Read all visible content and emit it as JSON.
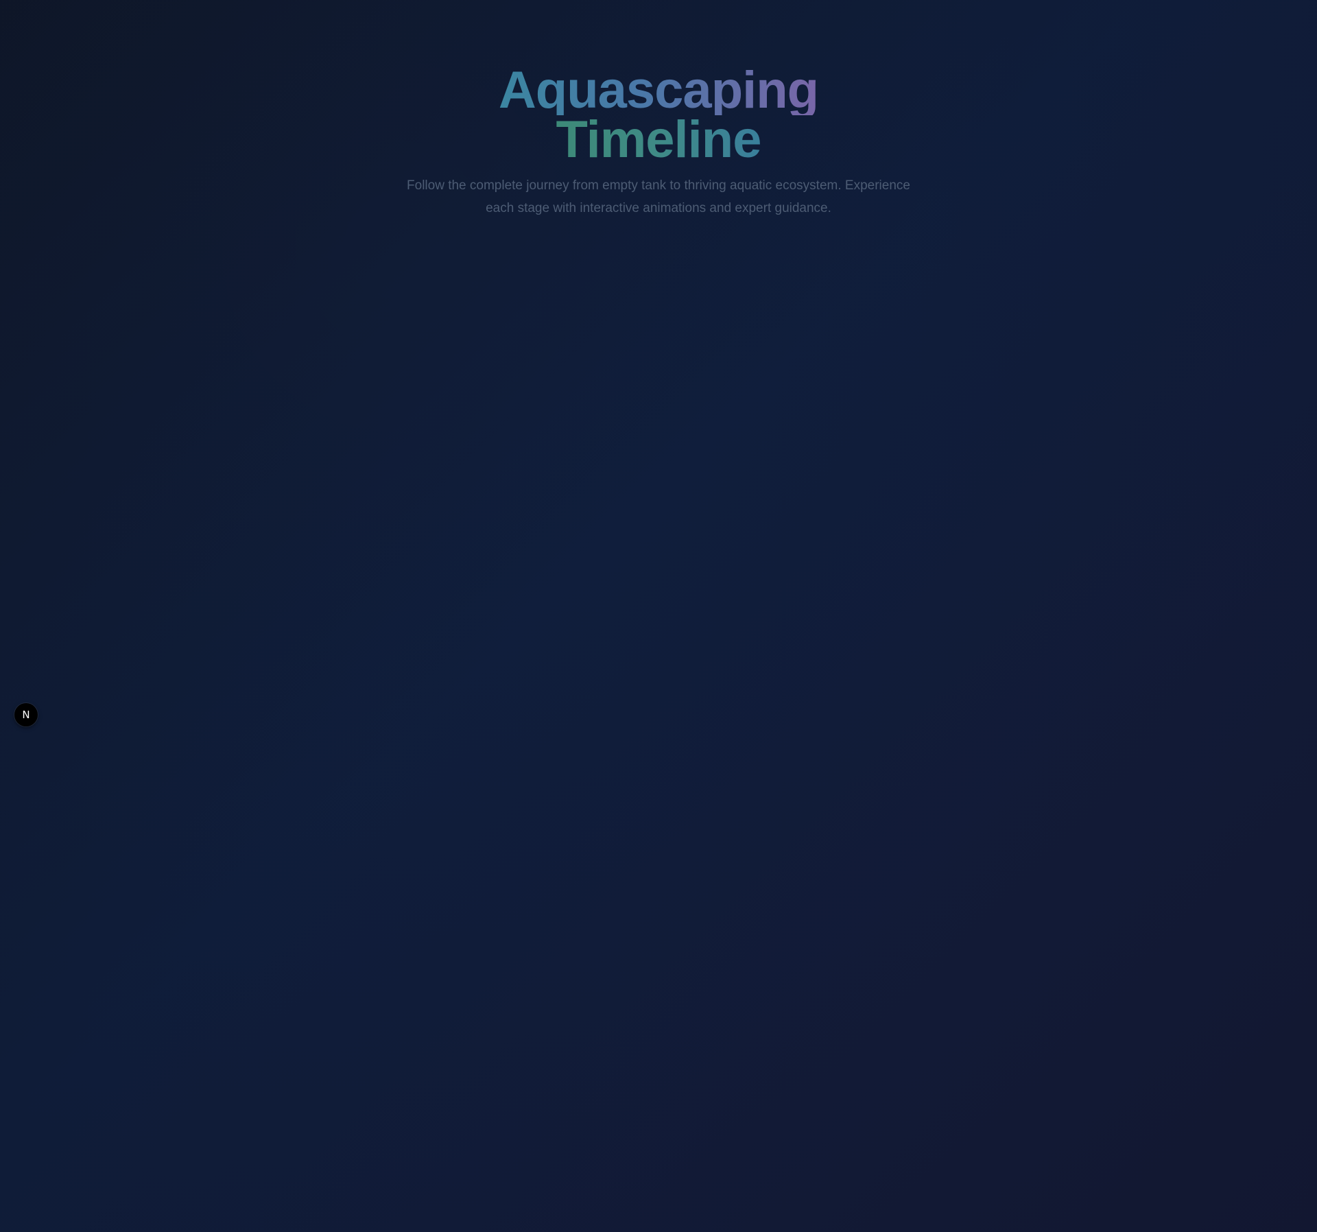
{
  "hero": {
    "title_line_1": "Aquascaping",
    "title_line_2": "Timeline",
    "subtitle": "Follow the complete journey from empty tank to thriving aquatic ecosystem. Experience each stage with interactive animations and expert guidance."
  },
  "dev_badge": {
    "label": "N",
    "icon": "nextjs-logo-icon"
  },
  "colors": {
    "background_start": "#0f1729",
    "background_mid": "#101f3e",
    "background_end": "#151a37",
    "title_gradient_start": "#3b86a1",
    "title_gradient_end": "#7966a8",
    "title_line_2_color": "#3d8a78",
    "subtitle_color": "#4d5c74",
    "badge_background": "#000000"
  }
}
